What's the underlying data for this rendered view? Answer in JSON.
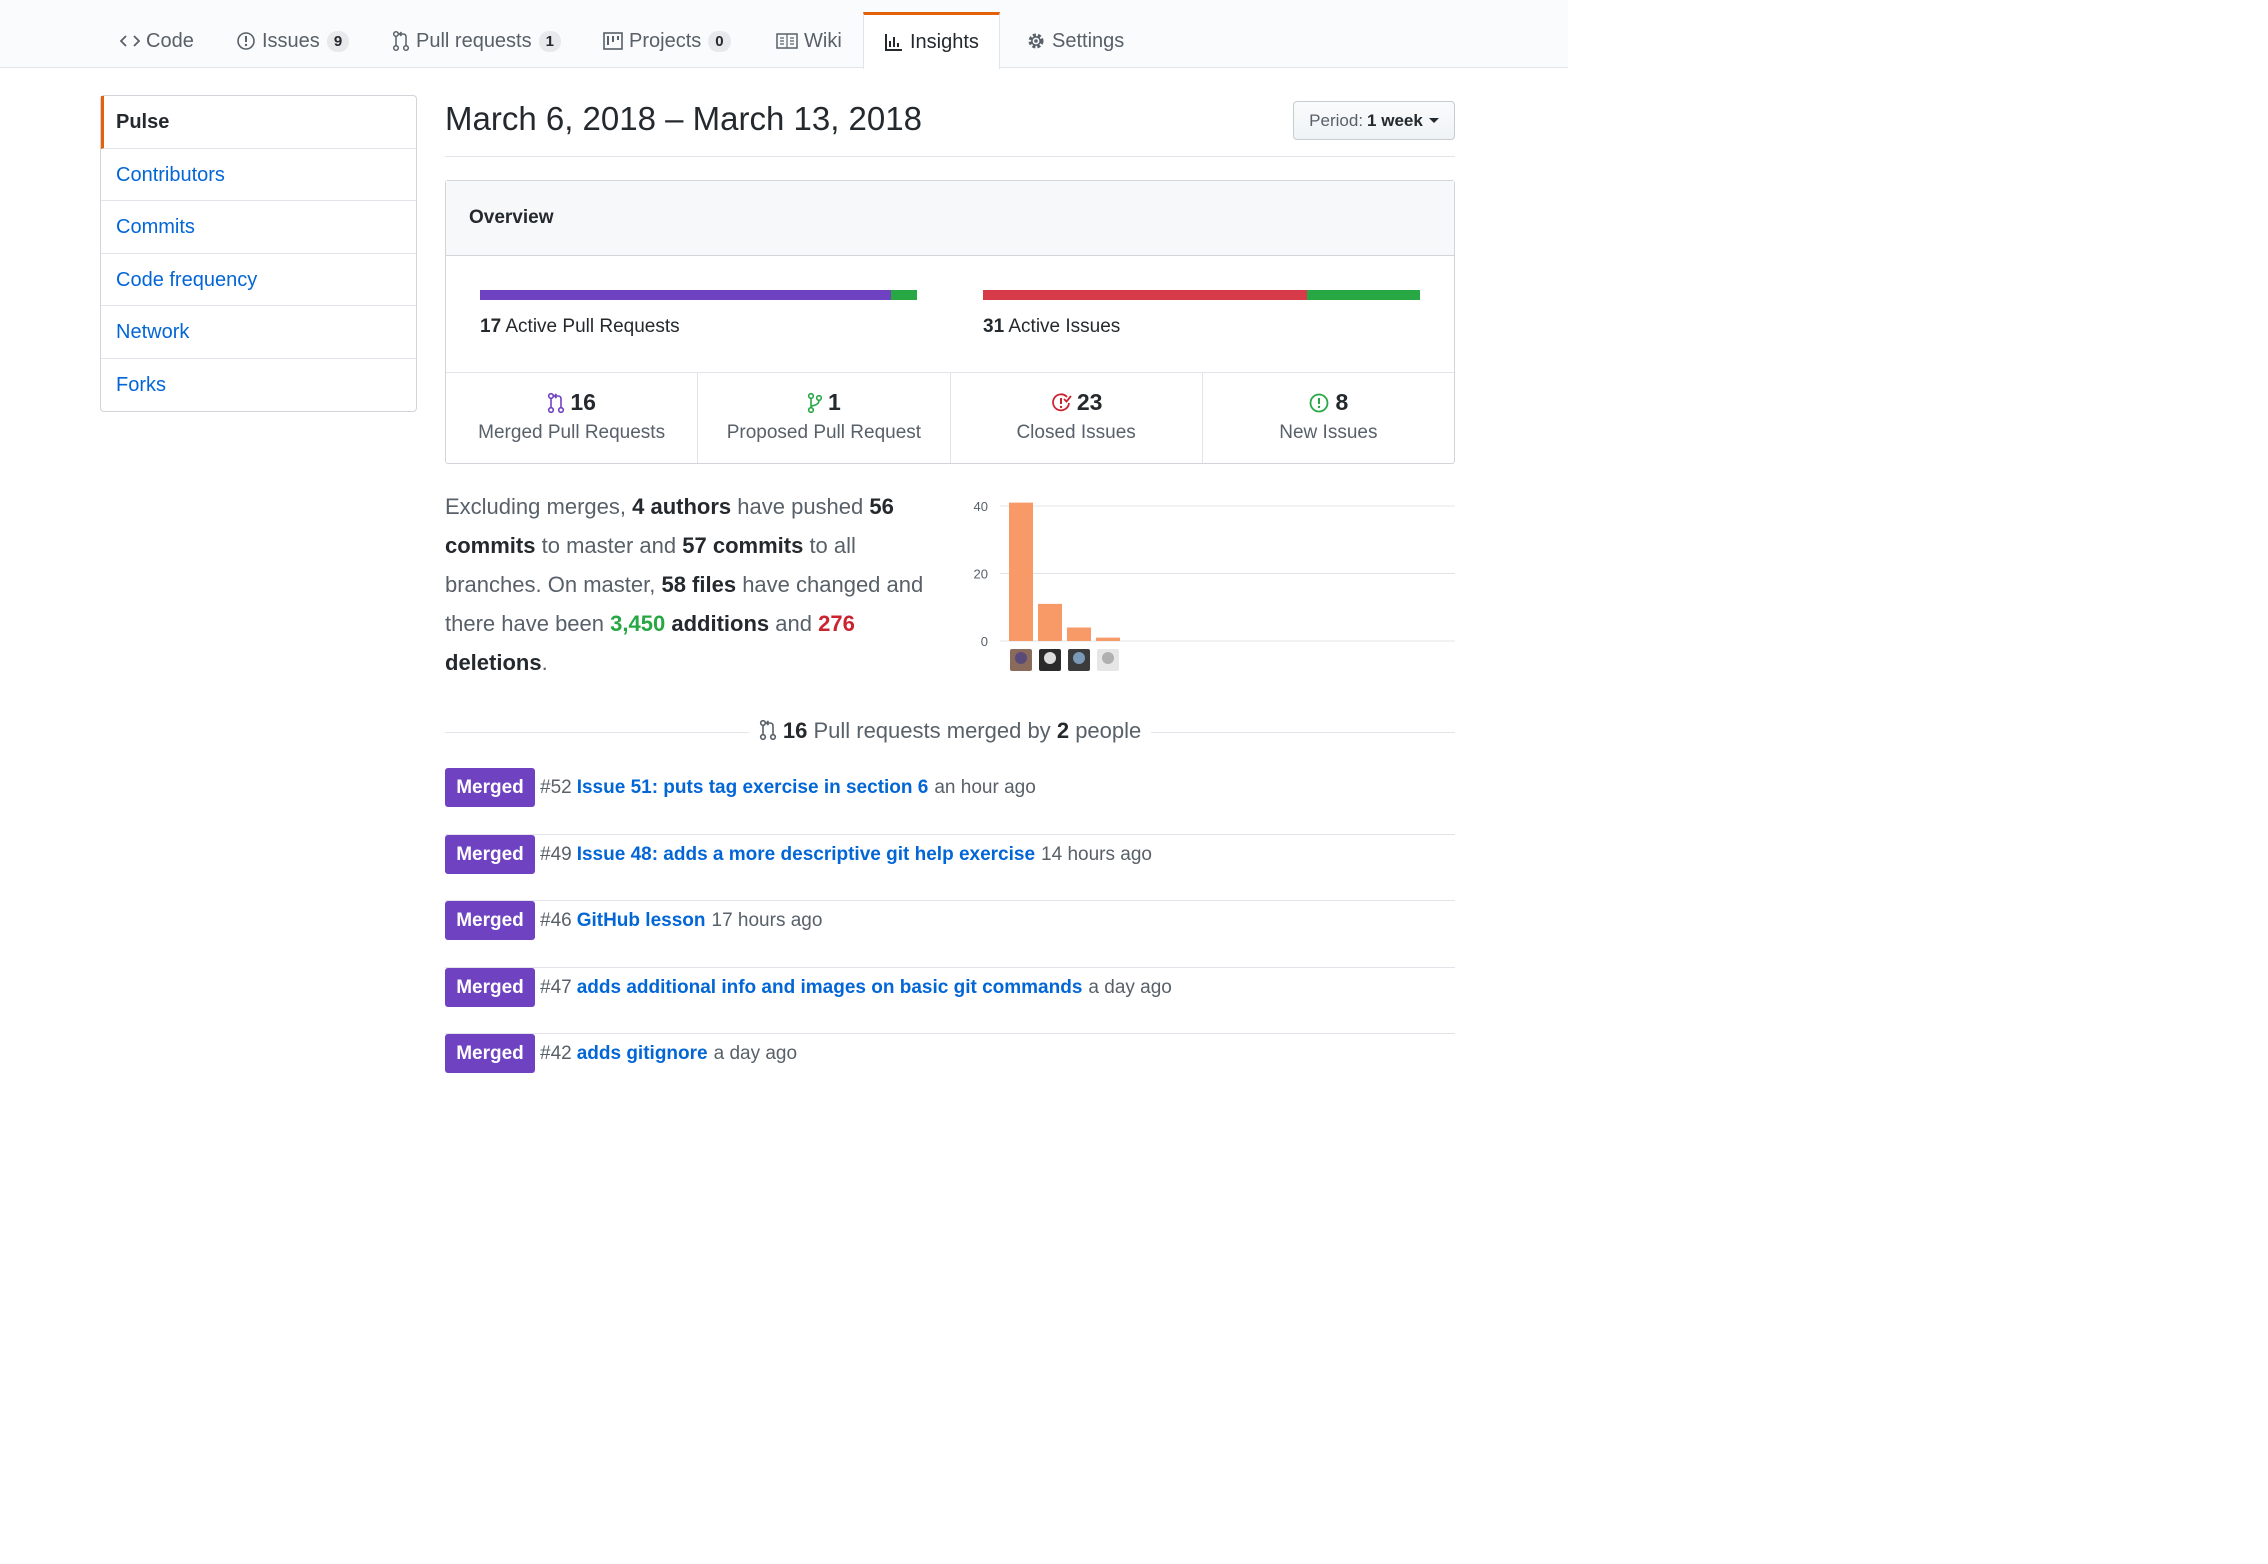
{
  "colors": {
    "accent": "#e36209",
    "link": "#0366d6",
    "purple": "#6f42c1",
    "green": "#28a745",
    "red": "#cb2431",
    "bar_orange": "#f79a67"
  },
  "tabs": [
    {
      "label": "Code",
      "icon": "code-icon",
      "counter": null
    },
    {
      "label": "Issues",
      "icon": "issue-opened-icon",
      "counter": "9"
    },
    {
      "label": "Pull requests",
      "icon": "git-pull-request-icon",
      "counter": "1"
    },
    {
      "label": "Projects",
      "icon": "project-icon",
      "counter": "0"
    },
    {
      "label": "Wiki",
      "icon": "book-icon",
      "counter": null
    },
    {
      "label": "Insights",
      "icon": "graph-icon",
      "counter": null,
      "selected": true
    },
    {
      "label": "Settings",
      "icon": "gear-icon",
      "counter": null
    }
  ],
  "sidebar": {
    "items": [
      {
        "label": "Pulse",
        "selected": true
      },
      {
        "label": "Contributors"
      },
      {
        "label": "Commits"
      },
      {
        "label": "Code frequency"
      },
      {
        "label": "Network"
      },
      {
        "label": "Forks"
      }
    ]
  },
  "main": {
    "date_range": "March 6, 2018 – March 13, 2018",
    "period_label": "Period:",
    "period_value": "1 week"
  },
  "overview": {
    "heading": "Overview",
    "pull_requests": {
      "count": "17",
      "label": "Active Pull Requests",
      "merged_fraction": 0.94,
      "open_fraction": 0.06
    },
    "issues": {
      "count": "31",
      "label": "Active Issues",
      "closed_fraction": 0.742,
      "new_fraction": 0.258
    },
    "stats": [
      {
        "number": "16",
        "label": "Merged Pull Requests",
        "icon": "git-merge-icon",
        "color": "#6f42c1"
      },
      {
        "number": "1",
        "label": "Proposed Pull Request",
        "icon": "git-pull-request-icon",
        "color": "#28a745"
      },
      {
        "number": "23",
        "label": "Closed Issues",
        "icon": "issue-closed-icon",
        "color": "#cb2431"
      },
      {
        "number": "8",
        "label": "New Issues",
        "icon": "issue-opened-icon",
        "color": "#28a745"
      }
    ]
  },
  "summary": {
    "p1": "Excluding merges,",
    "authors": "4 authors",
    "p2": "have pushed",
    "commits_master": "56 commits",
    "p3": "to master and",
    "commits_all": "57 commits",
    "p4": "to all branches. On master,",
    "files": "58 files",
    "p5": "have changed and there have been",
    "additions_num": "3,450",
    "additions_word": "additions",
    "p6": "and",
    "deletions_num": "276",
    "deletions_word": "deletions",
    "p7": "."
  },
  "chart_data": {
    "type": "bar",
    "categories": [
      "author-1",
      "author-2",
      "author-3",
      "author-4"
    ],
    "values": [
      41,
      11,
      4,
      1
    ],
    "ylim": [
      0,
      40
    ],
    "yticks": [
      0,
      20,
      40
    ],
    "grid": true,
    "xlabel": "",
    "ylabel": ""
  },
  "merged": {
    "count": "16",
    "text1": "Pull requests merged by",
    "people_count": "2",
    "text2": "people",
    "badge_label": "Merged",
    "items": [
      {
        "number": "#52",
        "title": "Issue 51: puts tag exercise in section 6",
        "time": "an hour ago"
      },
      {
        "number": "#49",
        "title": "Issue 48: adds a more descriptive git help exercise",
        "time": "14 hours ago"
      },
      {
        "number": "#46",
        "title": "GitHub lesson",
        "time": "17 hours ago"
      },
      {
        "number": "#47",
        "title": "adds additional info and images on basic git commands",
        "time": "a day ago"
      },
      {
        "number": "#42",
        "title": "adds gitignore",
        "time": "a day ago"
      }
    ]
  }
}
